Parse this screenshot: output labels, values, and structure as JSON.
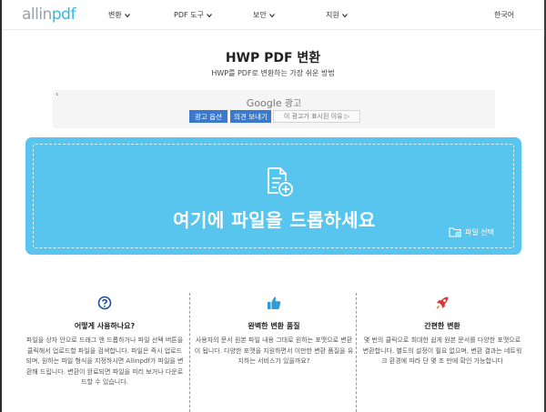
{
  "header": {
    "logo_main": "allin",
    "logo_accent": "pdf",
    "nav": [
      {
        "label": "변환"
      },
      {
        "label": "PDF 도구"
      },
      {
        "label": "보안"
      },
      {
        "label": "지원"
      }
    ],
    "language": "한국어"
  },
  "page": {
    "title": "HWP PDF 변환",
    "subtitle": "HWP를 PDF로 변환하는 가장 쉬운 방법"
  },
  "ad": {
    "back": "‹",
    "google": "Google",
    "label": "광고",
    "options": "광고 옵션",
    "feedback": "의견 보내기",
    "why": "이 광고가 표시된 이유 ▷"
  },
  "dropzone": {
    "text": "여기에 파일을 드롭하세요",
    "select_label": "파일 선택"
  },
  "features": [
    {
      "icon": "question-circle-icon",
      "title": "어떻게 사용하나요?",
      "desc": "파일을 상자 안으로 드래그 앤 드롭하거나 파일 선택 버튼을 클릭해서 업로드할 파일을 검색합니다. 파일은 즉시 업로드되며, 원하는 파일 형식을 지정하시면 Allinpdf가 파일을 변환해 드립니다. 변환이 완료되면 파일을 미리 보거나 다운로드할 수 있습니다."
    },
    {
      "icon": "thumbs-up-icon",
      "title": "완벽한 변환 품질",
      "desc": "사용자의 문서 원본 파일 내용 그대로 원하는 포맷으로 변환이 됩니다. 다양한 포맷을 지원하면서 이만한 변환 품질을 유지하는 서비스가 있을까요?"
    },
    {
      "icon": "rocket-icon",
      "title": "간편한 변환",
      "desc": "몇 번의 클릭으로 최대한 쉽게 원본 문서를 다양한 포맷으로 변환합니다. 별도의 설정이 필요 없으며, 변환 결과는 네트워크 환경에 따라 단 몇 초 만에 확인 가능합니다"
    }
  ],
  "colors": {
    "brand": "#30b9e6",
    "dropzone": "#58c5ef",
    "ad_button": "#3b79cc"
  }
}
